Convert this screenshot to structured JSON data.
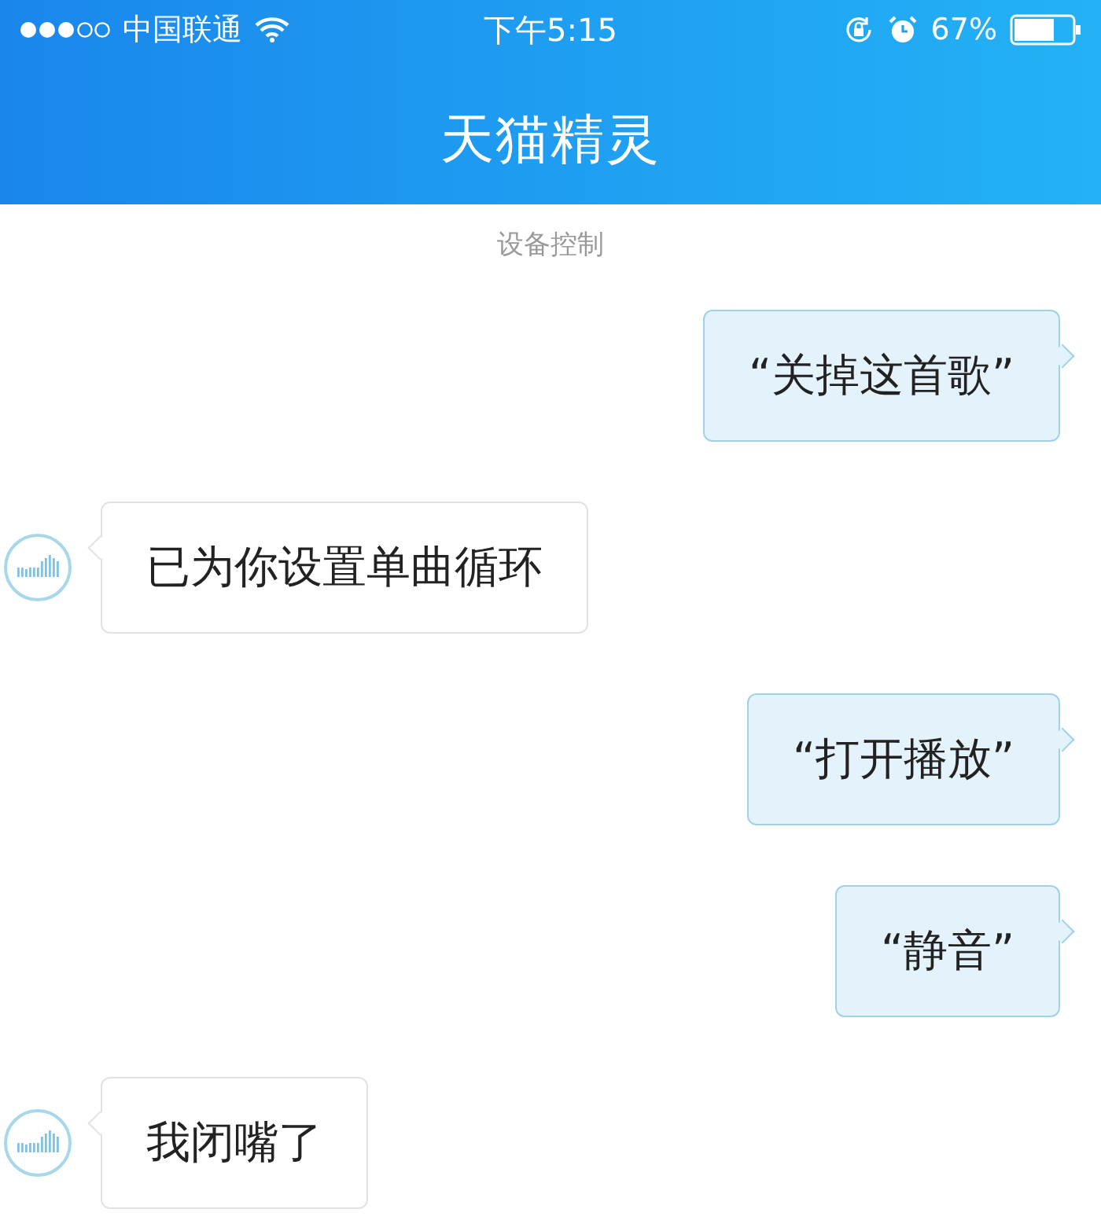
{
  "status_bar": {
    "carrier": "中国联通",
    "time": "下午5:15",
    "battery_percent": "67%"
  },
  "header": {
    "title": "天猫精灵"
  },
  "chat": {
    "section_label": "设备控制",
    "messages": [
      {
        "kind": "user",
        "text": "“关掉这首歌”"
      },
      {
        "kind": "bot",
        "text": "已为你设置单曲循环"
      },
      {
        "kind": "user",
        "text": "“打开播放”"
      },
      {
        "kind": "user",
        "text": "“静音”"
      },
      {
        "kind": "bot",
        "text": "我闭嘴了"
      }
    ]
  }
}
